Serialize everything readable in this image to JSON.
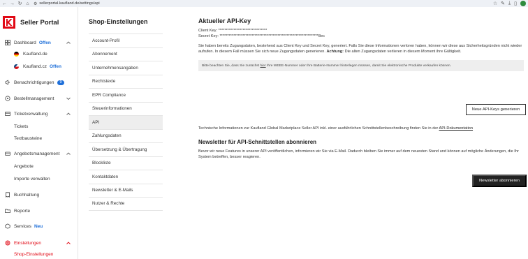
{
  "browser": {
    "url": "sellerportal.kaufland.de/settings/api"
  },
  "brand": {
    "title": "Seller Portal"
  },
  "sidebar": {
    "dashboard": {
      "label": "Dashboard",
      "badge": "Offen"
    },
    "markets": [
      {
        "label": "Kaufland.de",
        "badge": ""
      },
      {
        "label": "Kaufland.cz",
        "badge": "Offen"
      }
    ],
    "notifications": {
      "label": "Benachrichtigungen",
      "count": "9"
    },
    "orders": {
      "label": "Bestellmanagement"
    },
    "tickets": {
      "label": "Ticketverwaltung",
      "sub": [
        "Tickets",
        "Textbausteine"
      ]
    },
    "offers": {
      "label": "Angebotsmanagement",
      "sub": [
        "Angebote",
        "Importe verwalten"
      ]
    },
    "accounting": {
      "label": "Buchhaltung"
    },
    "reports": {
      "label": "Reporte"
    },
    "services": {
      "label": "Services",
      "badge": "Neu"
    },
    "settings": {
      "label": "Einstellungen",
      "sub": [
        "Shop-Einstellungen"
      ]
    }
  },
  "settings_menu": {
    "title": "Shop-Einstellungen",
    "items": [
      "Account-Profil",
      "Abonnement",
      "Unternehmensangaben",
      "Rechtstexte",
      "EPR Compliance",
      "Steuerinformationen",
      "API",
      "Zahlungsdaten",
      "Übersetzung & Übertragung",
      "Blockliste",
      "Kontaktdaten",
      "Newsletter & E-Mails",
      "Nutzer & Rechte"
    ],
    "active_index": 6
  },
  "api": {
    "title": "Aktueller API-Key",
    "client_key_label": "Client Key:",
    "client_key_value": "********************************",
    "secret_key_label": "Secret Key:",
    "secret_key_value": "*****************************************************************8ec",
    "info_text": "Sie haben bereits Zugangsdaten, bestehend aus Client Key und Secret Key, generiert. Falls Sie diese Informationen verloren haben, können wir diese aus Sicherheitsgründen nicht wieder aufrufen. In diesem Fall müssen Sie sich neue Zugangsdaten generieren.",
    "info_warning_label": "Achtung:",
    "info_warning_text": "Die alten Zugangsdaten verlieren in diesem Moment ihre Gültigkeit.",
    "notice_before": "Bitte beachten Sie, dass Sie zunächst",
    "notice_link": "hier",
    "notice_after": "Ihre WEEE-Nummer oder Ihre Batterie-Nummer hinterlegen müssen, damit Sie elektronische Produkte verkaufen können.",
    "generate_button": "Neue API-Keys generieren",
    "tech_text": "Technische Informationen zur Kaufland Global Marketplace Seller API inkl. einer ausführlichen Schnittstellenbeschreibung finden Sie in der",
    "tech_link": "API-Dokumentation"
  },
  "newsletter": {
    "title": "Newsletter für API-Schnittstellen abonnieren",
    "text": "Bevor wir neue Features in unserer API veröffentlichen, informieren wir Sie via E-Mail. Dadurch bleiben Sie immer auf dem neuesten Stand und können auf mögliche Änderungen, die Ihr System betreffen, besser reagieren.",
    "button": "Newsletter abonnieren"
  }
}
